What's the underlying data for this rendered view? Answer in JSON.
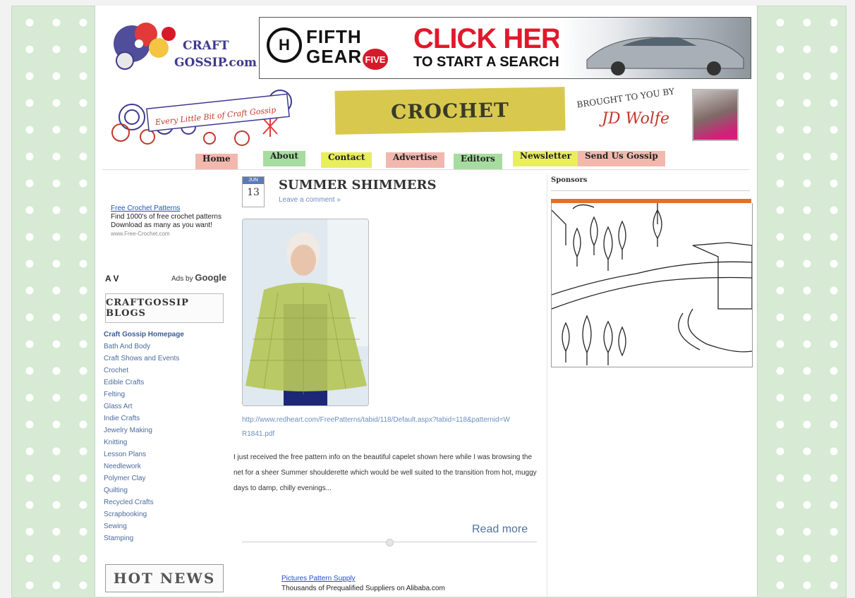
{
  "site": {
    "logo_text": "CRAFT GOSSIP.com",
    "tagline": "Every Little Bit of Craft Gossip",
    "section_title": "CROCHET",
    "brought_by": "BROUGHT TO YOU BY",
    "editor_name": "JD Wolfe"
  },
  "banner": {
    "brand_line1": "FIFTH",
    "brand_line2": "GEAR",
    "channel": "FIVE",
    "cta_line1": "CLICK HERE",
    "cta_line2": "TO START A SEARCH"
  },
  "nav": [
    {
      "label": "Home",
      "color": "#f2b8ae"
    },
    {
      "label": "About",
      "color": "#a7dca0"
    },
    {
      "label": "Contact",
      "color": "#e9ee5e"
    },
    {
      "label": "Advertise",
      "color": "#f2b8ae"
    },
    {
      "label": "Editors",
      "color": "#a7dca0"
    },
    {
      "label": "Newsletter",
      "color": "#e9ee5e"
    },
    {
      "label": "Send Us Gossip",
      "color": "#f2b8ae"
    }
  ],
  "sidebar": {
    "ad": {
      "title": "Free Crochet Patterns",
      "desc": "Find 1000's of free crochet patterns Download as many as you want!",
      "url": "www.Free-Crochet.com"
    },
    "av_label": "A V",
    "ads_by": "Ads by",
    "google": "Google",
    "blogs_title": "CRAFTGOSSIP BLOGS",
    "categories": [
      "Craft Gossip Homepage",
      "Bath And Body",
      "Craft Shows and Events",
      "Crochet",
      "Edible Crafts",
      "Felting",
      "Glass Art",
      "Indie Crafts",
      "Jewelry Making",
      "Knitting",
      "Lesson Plans",
      "Needlework",
      "Polymer Clay",
      "Quilting",
      "Recycled Crafts",
      "Scrapbooking",
      "Sewing",
      "Stamping"
    ],
    "hot_news": "HOT NEWS"
  },
  "post": {
    "month": "JUN",
    "day": "13",
    "title": "SUMMER SHIMMERS",
    "leave_comment": "Leave a comment »",
    "link": "http://www.redheart.com/FreePatterns/tabid/118/Default.aspx?tabid=118&patternid=WR1841.pdf",
    "body": "I just received the free pattern info on the beautiful capelet shown here while I was browsing the net for a sheer Summer shoulderette which would be well suited to the transition from hot, muggy days to damp, chilly evenings...",
    "read_more": "Read more"
  },
  "bottom_ad": {
    "title": "Pictures Pattern Supply",
    "desc": "Thousands of Prequalified Suppliers on Alibaba.com"
  },
  "right": {
    "sponsors": "Sponsors"
  },
  "colors": {
    "background_green": "#d6ead4",
    "accent_orange": "#e0722c",
    "link_blue": "#1d53c7"
  }
}
